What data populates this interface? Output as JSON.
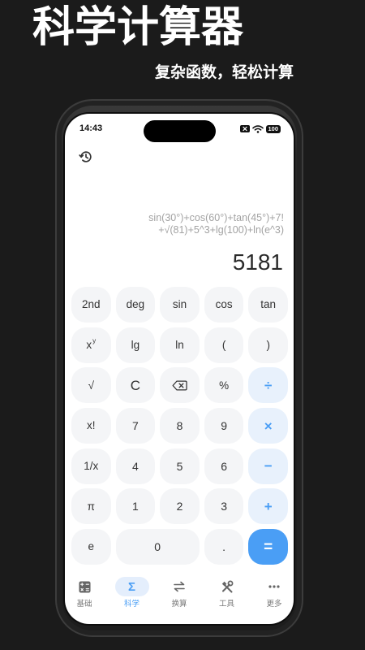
{
  "header": {
    "title": "科学计算器",
    "subtitle": "复杂函数，轻松计算"
  },
  "status_bar": {
    "time": "14:43",
    "battery": "100",
    "icons": [
      "sim-off-icon",
      "wifi-icon",
      "battery-icon"
    ]
  },
  "display": {
    "history_icon": "history-icon",
    "expression": [
      "sin(30°)+cos(60°)+tan(45°)+7!",
      "+√(81)+5^3+lg(100)+ln(e^3)"
    ],
    "result": "5181"
  },
  "keypad": {
    "rows": [
      [
        {
          "label": "2nd"
        },
        {
          "label": "deg"
        },
        {
          "label": "sin"
        },
        {
          "label": "cos"
        },
        {
          "label": "tan"
        }
      ],
      [
        {
          "label": "x",
          "superscript": "y"
        },
        {
          "label": "lg"
        },
        {
          "label": "ln"
        },
        {
          "label": "("
        },
        {
          "label": ")"
        }
      ],
      [
        {
          "label": "√"
        },
        {
          "label": "C"
        },
        {
          "icon": "backspace-icon"
        },
        {
          "label": "%"
        },
        {
          "label": "÷"
        }
      ],
      [
        {
          "label": "x!"
        },
        {
          "label": "7"
        },
        {
          "label": "8"
        },
        {
          "label": "9"
        },
        {
          "label": "×"
        }
      ],
      [
        {
          "label": "1/x"
        },
        {
          "label": "4"
        },
        {
          "label": "5"
        },
        {
          "label": "6"
        },
        {
          "label": "−"
        }
      ],
      [
        {
          "label": "π"
        },
        {
          "label": "1"
        },
        {
          "label": "2"
        },
        {
          "label": "3"
        },
        {
          "label": "+"
        }
      ],
      [
        {
          "label": "e"
        },
        {
          "label": "0"
        },
        {
          "label": "."
        },
        {
          "label": "="
        }
      ]
    ]
  },
  "tab_bar": {
    "items": [
      {
        "label": "基础",
        "icon": "calculator-icon"
      },
      {
        "label": "科学",
        "icon": "sigma-icon",
        "glyph": "Σ",
        "active": true
      },
      {
        "label": "换算",
        "icon": "exchange-icon"
      },
      {
        "label": "工具",
        "icon": "tools-icon"
      },
      {
        "label": "更多",
        "icon": "more-icon"
      }
    ]
  },
  "colors": {
    "page_background": "#1b1b1b",
    "key_background": "#f4f5f7",
    "operator_background": "#e8f1fc",
    "accent": "#4a9ef5",
    "key_text": "#333333",
    "expression_text": "#a3a3a3",
    "tab_text": "#7a7a7a",
    "tab_active_background": "#e4eefc"
  }
}
